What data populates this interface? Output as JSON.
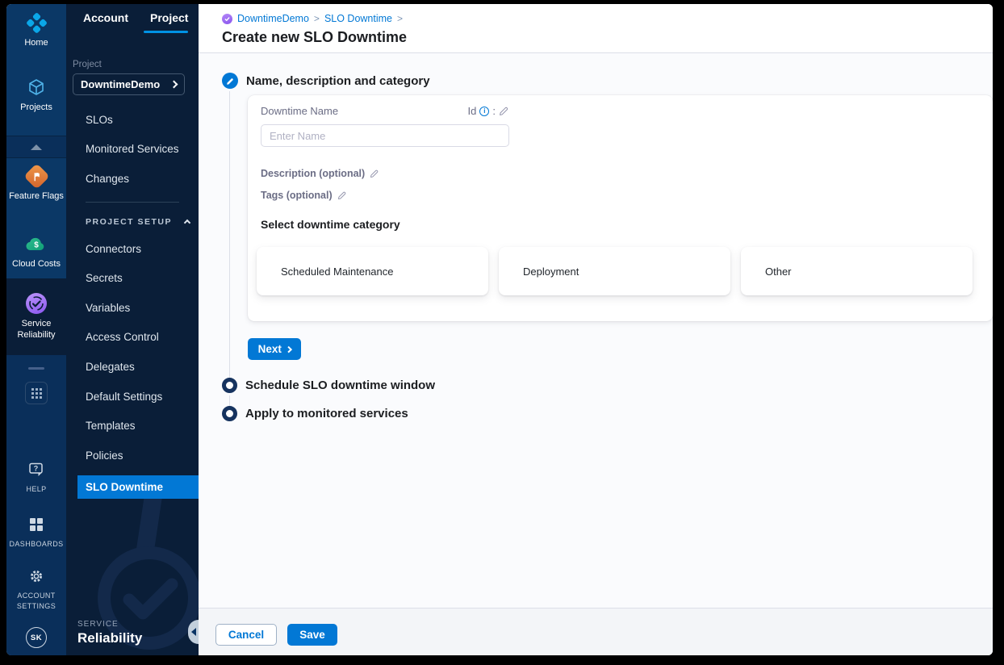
{
  "rail": {
    "home_label": "Home",
    "projects_label": "Projects",
    "feature_flags_label": "Feature Flags",
    "cloud_costs_label": "Cloud Costs",
    "service_reliability_label1": "Service",
    "service_reliability_label2": "Reliability",
    "help_label": "HELP",
    "dashboards_label": "DASHBOARDS",
    "account_settings_label1": "ACCOUNT",
    "account_settings_label2": "SETTINGS",
    "avatar_initials": "SK"
  },
  "sidebar": {
    "tabs": [
      {
        "label": "Account"
      },
      {
        "label": "Project"
      }
    ],
    "project_section_label": "Project",
    "project_name": "DowntimeDemo",
    "nav_items": [
      {
        "label": "SLOs"
      },
      {
        "label": "Monitored Services"
      },
      {
        "label": "Changes"
      }
    ],
    "setup_section_label": "PROJECT SETUP",
    "setup_items": [
      {
        "label": "Connectors"
      },
      {
        "label": "Secrets"
      },
      {
        "label": "Variables"
      },
      {
        "label": "Access Control"
      },
      {
        "label": "Delegates"
      },
      {
        "label": "Default Settings"
      },
      {
        "label": "Templates"
      },
      {
        "label": "Policies"
      }
    ],
    "active_item_label": "SLO Downtime",
    "brand_label1": "SERVICE",
    "brand_label2": "Reliability"
  },
  "header": {
    "breadcrumb": [
      {
        "label": "DowntimeDemo"
      },
      {
        "label": "SLO Downtime"
      }
    ],
    "separator": ">",
    "title": "Create new SLO Downtime"
  },
  "wizard": {
    "step1_label": "Name, description and category",
    "step2_label": "Schedule SLO downtime window",
    "step3_label": "Apply to monitored services",
    "next_label": "Next"
  },
  "form": {
    "name_label": "Downtime Name",
    "id_label": "Id",
    "id_colon": ":",
    "name_placeholder": "Enter Name",
    "description_label": "Description (optional)",
    "tags_label": "Tags (optional)",
    "category_heading": "Select downtime category",
    "categories": [
      {
        "label": "Scheduled Maintenance"
      },
      {
        "label": "Deployment"
      },
      {
        "label": "Other"
      }
    ]
  },
  "footer": {
    "cancel_label": "Cancel",
    "save_label": "Save"
  },
  "colors": {
    "accent": "#0278d5",
    "tab_underline": "#0092e4",
    "rail_bg": "#0b3866",
    "sidebar_bg": "#0a1e38",
    "content_bg": "#fafbfd"
  }
}
